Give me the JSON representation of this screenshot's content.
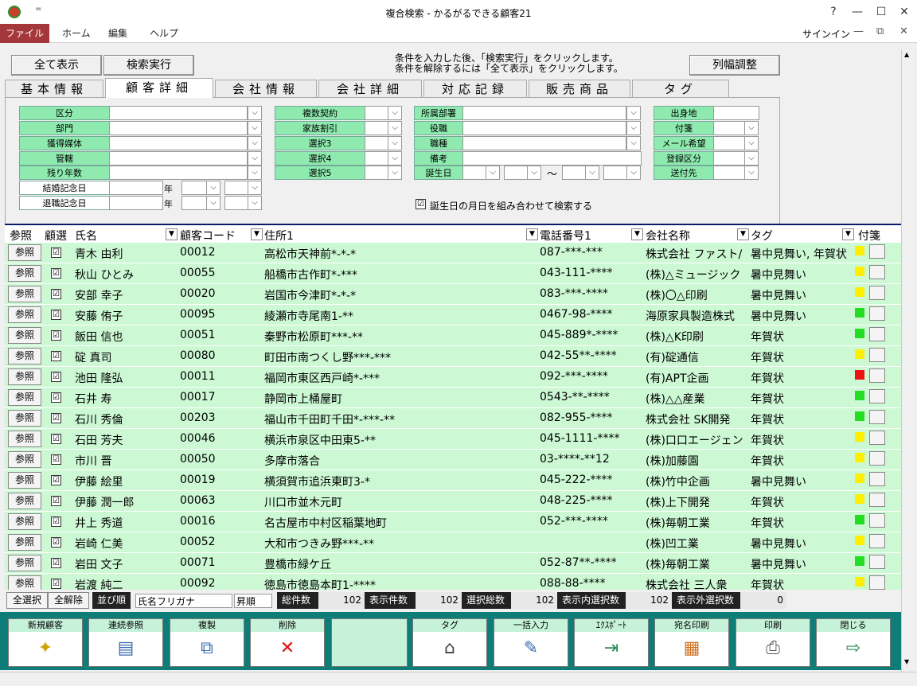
{
  "window": {
    "title": "複合検索 - かるがるできる顧客21",
    "help": "?",
    "minimize": "—",
    "maximize": "☐",
    "close": "✕",
    "qat": "="
  },
  "ribbon": {
    "tabs": [
      "ファイル",
      "ホーム",
      "編集",
      "ヘルプ"
    ],
    "signin": "サインイン",
    "min": "—",
    "restore": "⧉",
    "close": "✕"
  },
  "toolbar": {
    "show_all": "全て表示",
    "search": "検索実行",
    "col_adjust": "列幅調整",
    "note1": "条件を入力した後、「検索実行」をクリックします。",
    "note2": "条件を解除するには「全て表示」をクリックします。"
  },
  "tabs": [
    "基本情報",
    "顧客詳細",
    "会社情報",
    "会社詳細",
    "対応記録",
    "販売商品",
    "タグ"
  ],
  "form": {
    "col1": [
      "区分",
      "部門",
      "獲得媒体",
      "管轄",
      "残り年数",
      "結婚記念日",
      "退職記念日"
    ],
    "year": "年",
    "col2": [
      "複数契約",
      "家族割引",
      "選択3",
      "選択4",
      "選択5"
    ],
    "col3": [
      "所属部署",
      "役職",
      "職種",
      "備考",
      "誕生日"
    ],
    "tilde": "〜",
    "col4": [
      "出身地",
      "付箋",
      "メール希望",
      "登録区分",
      "送付先"
    ],
    "birthday_combine": "誕生日の月日を組み合わせて検索する"
  },
  "grid": {
    "headers": {
      "ref": "参照",
      "select": "顧選",
      "name": "氏名",
      "code": "顧客コード",
      "address": "住所1",
      "phone": "電話番号1",
      "company": "会社名称",
      "tag": "タグ",
      "sticky": "付箋"
    },
    "ref_label": "参照",
    "check": "☑",
    "rows": [
      {
        "name": "青木 由利",
        "code": "00012",
        "address": "高松市天神前*-*-*",
        "phone": "087-***-***",
        "company": "株式会社 ファスト/",
        "tag": "暑中見舞い, 年賀状",
        "color": "#ffee00"
      },
      {
        "name": "秋山 ひとみ",
        "code": "00055",
        "address": "船橋市古作町*-***",
        "phone": "043-111-****",
        "company": "(株)△ミュージック",
        "tag": "暑中見舞い",
        "color": "#ffee00"
      },
      {
        "name": "安部 幸子",
        "code": "00020",
        "address": "岩国市今津町*-*-*",
        "phone": "083-***-****",
        "company": "(株)〇△印刷",
        "tag": "暑中見舞い",
        "color": "#ffee00"
      },
      {
        "name": "安藤 侑子",
        "code": "00095",
        "address": "綾瀬市寺尾南1-**",
        "phone": "0467-98-****",
        "company": "海原家具製造株式",
        "tag": "暑中見舞い",
        "color": "#22dd22"
      },
      {
        "name": "飯田 信也",
        "code": "00051",
        "address": "秦野市松原町***-**",
        "phone": "045-889*-****",
        "company": "(株)△K印刷",
        "tag": "年賀状",
        "color": "#22dd22"
      },
      {
        "name": "碇 真司",
        "code": "00080",
        "address": "町田市南つくし野***-***",
        "phone": "042-55**-****",
        "company": "(有)碇通信",
        "tag": "年賀状",
        "color": "#ffee00"
      },
      {
        "name": "池田 隆弘",
        "code": "00011",
        "address": "福岡市東区西戸崎*-***",
        "phone": "092-***-****",
        "company": "(有)APT企画",
        "tag": "年賀状",
        "color": "#ee1111"
      },
      {
        "name": "石井 寿",
        "code": "00017",
        "address": "静岡市上桶屋町",
        "phone": "0543-**-****",
        "company": "(株)△△産業",
        "tag": "年賀状",
        "color": "#22dd22"
      },
      {
        "name": "石川 秀倫",
        "code": "00203",
        "address": "福山市千田町千田*-***-**",
        "phone": "082-955-****",
        "company": "株式会社 SK開発",
        "tag": "年賀状",
        "color": "#22dd22"
      },
      {
        "name": "石田 芳夫",
        "code": "00046",
        "address": "横浜市泉区中田東5-**",
        "phone": "045-1111-****",
        "company": "(株)口口エージェン",
        "tag": "年賀状",
        "color": "#ffee00"
      },
      {
        "name": "市川 晋",
        "code": "00050",
        "address": "多摩市落合",
        "phone": "03-****-**12",
        "company": "(株)加藤園",
        "tag": "年賀状",
        "color": "#ffee00"
      },
      {
        "name": "伊藤 絵里",
        "code": "00019",
        "address": "横須賀市追浜東町3-*",
        "phone": "045-222-****",
        "company": "(株)竹中企画",
        "tag": "暑中見舞い",
        "color": "#ffee00"
      },
      {
        "name": "伊藤 潤一郎",
        "code": "00063",
        "address": "川口市並木元町",
        "phone": "048-225-****",
        "company": "(株)上下開発",
        "tag": "年賀状",
        "color": "#ffee00"
      },
      {
        "name": "井上 秀道",
        "code": "00016",
        "address": "名古屋市中村区稲葉地町",
        "phone": "052-***-****",
        "company": "(株)毎朝工業",
        "tag": "年賀状",
        "color": "#22dd22"
      },
      {
        "name": "岩崎 仁美",
        "code": "00052",
        "address": "大和市つきみ野***-**",
        "phone": "",
        "company": "(株)凹工業",
        "tag": "暑中見舞い",
        "color": "#ffee00"
      },
      {
        "name": "岩田 文子",
        "code": "00071",
        "address": "豊橋市緑ケ丘",
        "phone": "052-87**-****",
        "company": "(株)毎朝工業",
        "tag": "暑中見舞い",
        "color": "#22dd22"
      },
      {
        "name": "岩渡 純二",
        "code": "00092",
        "address": "徳島市徳島本町1-****",
        "phone": "088-88-****",
        "company": "株式会社 三人衆",
        "tag": "年賀状",
        "color": "#ffee00"
      }
    ]
  },
  "status": {
    "select_all": "全選択",
    "deselect_all": "全解除",
    "sort_label": "並び順",
    "sort_field": "氏名フリガナ",
    "sort_order": "昇順",
    "total_label": "総件数",
    "total": "102",
    "shown_label": "表示件数",
    "shown": "102",
    "selected_label": "選択総数",
    "selected": "102",
    "shown_selected_label": "表示内選択数",
    "shown_selected": "102",
    "hidden_selected_label": "表示外選択数",
    "hidden_selected": "0"
  },
  "actions": [
    "新規顧客",
    "連続参照",
    "複製",
    "削除",
    "タグ",
    "一括入力",
    "ｴｸｽﾎﾟｰﾄ",
    "宛名印刷",
    "印刷",
    "閉じる"
  ]
}
